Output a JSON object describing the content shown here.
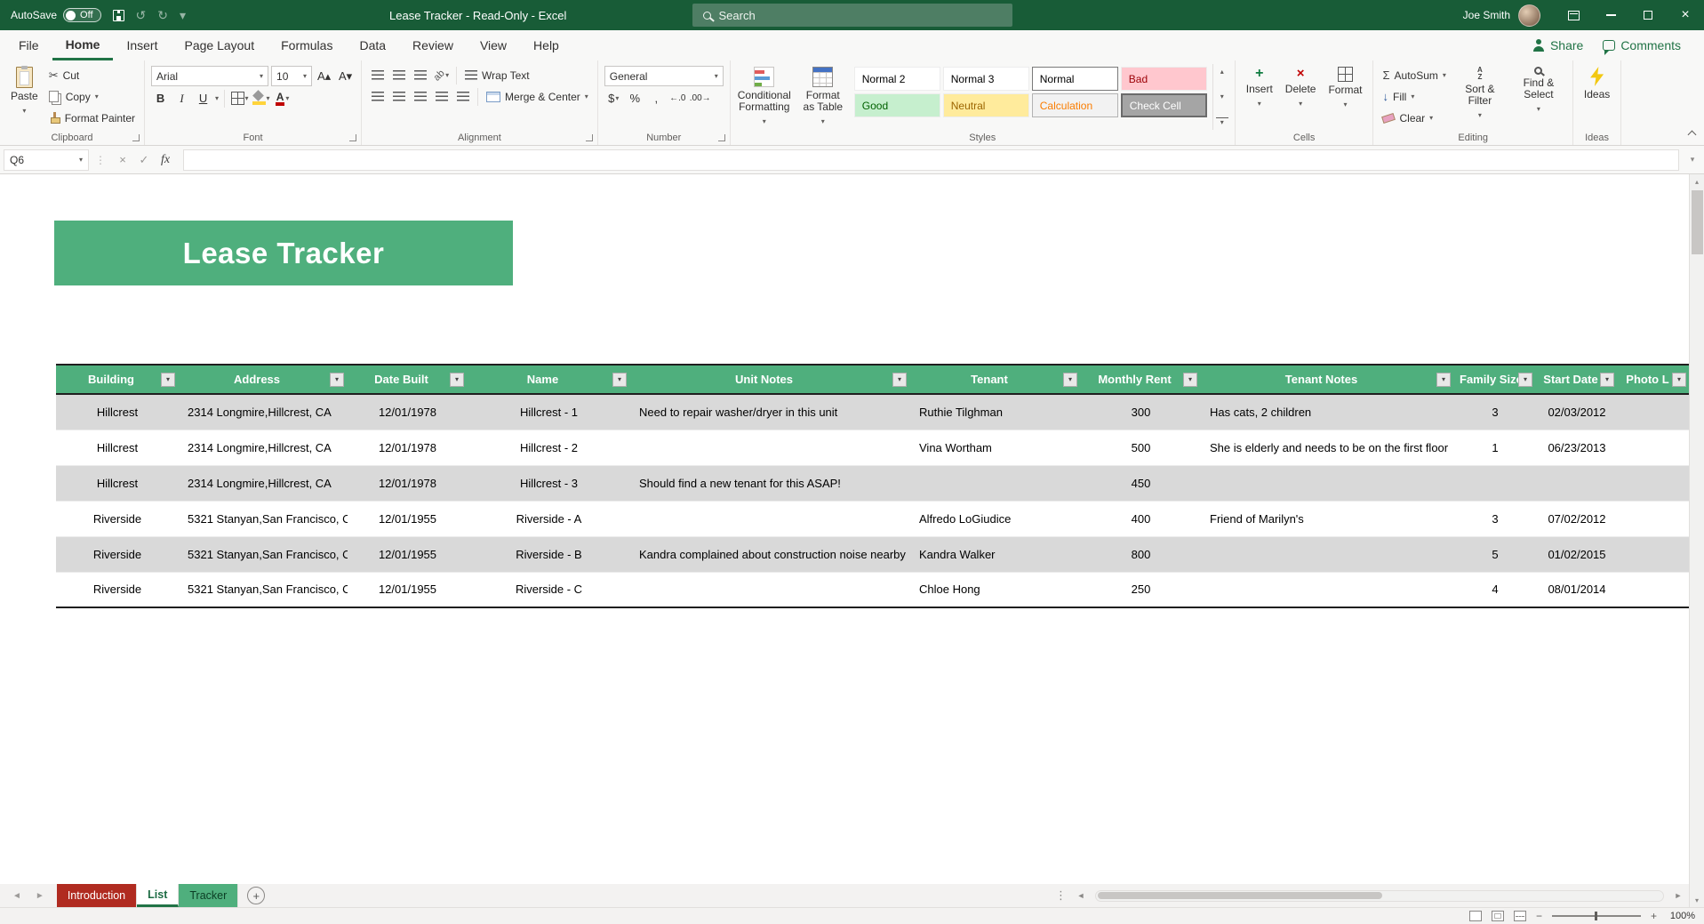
{
  "glyphs": {
    "dropdown": "▾",
    "scissors": "✂",
    "undo": "↺",
    "redo": "↻",
    "check": "✓",
    "cross": "×",
    "sigma": "Σ",
    "dollar": "$",
    "percent": "%",
    "comma": ",",
    "increase_decimal": "←.0",
    "decrease_decimal": ".00→",
    "font_grow": "A▴",
    "font_shrink": "A▾",
    "letter_a": "A",
    "letter_z": "Z",
    "ab": "ab",
    "fill_down": "↓",
    "plus": "+",
    "minus": "−",
    "nav_left": "◄",
    "nav_right": "►",
    "up_small": "▴",
    "down_small": "▾",
    "dots_v": "⋮"
  },
  "title_bar": {
    "autosave_label": "AutoSave",
    "autosave_state": "Off",
    "title": "Lease Tracker - Read-Only - Excel",
    "search_placeholder": "Search",
    "user_name": "Joe Smith"
  },
  "ribbon_tabs": {
    "items": [
      "File",
      "Home",
      "Insert",
      "Page Layout",
      "Formulas",
      "Data",
      "Review",
      "View",
      "Help"
    ],
    "active": "Home",
    "share_label": "Share",
    "comments_label": "Comments"
  },
  "ribbon": {
    "clipboard": {
      "group_label": "Clipboard",
      "paste_label": "Paste",
      "cut_label": "Cut",
      "copy_label": "Copy",
      "format_painter_label": "Format Painter"
    },
    "font": {
      "group_label": "Font",
      "font_name": "Arial",
      "font_size": "10",
      "bold_label": "B",
      "italic_label": "I",
      "underline_label": "U"
    },
    "alignment": {
      "group_label": "Alignment",
      "wrap_text_label": "Wrap Text",
      "merge_center_label": "Merge & Center"
    },
    "number": {
      "group_label": "Number",
      "format_value": "General"
    },
    "styles": {
      "group_label": "Styles",
      "conditional_formatting_label": "Conditional Formatting",
      "format_as_table_label": "Format as Table",
      "gallery": [
        {
          "label": "Normal 2",
          "kind": "plain"
        },
        {
          "label": "Normal 3",
          "kind": "plain"
        },
        {
          "label": "Normal",
          "kind": "selected"
        },
        {
          "label": "Bad",
          "kind": "bad"
        },
        {
          "label": "Good",
          "kind": "good"
        },
        {
          "label": "Neutral",
          "kind": "neutral"
        },
        {
          "label": "Calculation",
          "kind": "calculation"
        },
        {
          "label": "Check Cell",
          "kind": "checkcell"
        }
      ]
    },
    "cells": {
      "group_label": "Cells",
      "insert_label": "Insert",
      "delete_label": "Delete",
      "format_label": "Format"
    },
    "editing": {
      "group_label": "Editing",
      "autosum_label": "AutoSum",
      "fill_label": "Fill",
      "clear_label": "Clear",
      "sort_filter_label": "Sort & Filter",
      "find_select_label": "Find & Select"
    },
    "ideas": {
      "group_label": "Ideas",
      "button_label": "Ideas"
    }
  },
  "formula_bar": {
    "name_box_value": "Q6",
    "fx_label": "fx",
    "formula_value": ""
  },
  "sheet": {
    "banner_title": "Lease Tracker",
    "columns": [
      "Building",
      "Address",
      "Date Built",
      "Name",
      "Unit Notes",
      "Tenant",
      "Monthly Rent",
      "Tenant Notes",
      "Family Size",
      "Start Date",
      "Photo L"
    ],
    "rows": [
      [
        "Hillcrest",
        "2314 Longmire,Hillcrest, CA",
        "12/01/1978",
        "Hillcrest - 1",
        "Need to repair washer/dryer in this unit",
        "Ruthie Tilghman",
        "300",
        "Has cats, 2 children",
        "3",
        "02/03/2012"
      ],
      [
        "Hillcrest",
        "2314 Longmire,Hillcrest, CA",
        "12/01/1978",
        "Hillcrest - 2",
        "",
        "Vina Wortham",
        "500",
        "She is elderly and needs to be on the first floor",
        "1",
        "06/23/2013"
      ],
      [
        "Hillcrest",
        "2314 Longmire,Hillcrest, CA",
        "12/01/1978",
        "Hillcrest - 3",
        "Should find a new tenant for this ASAP!",
        "",
        "450",
        "",
        "",
        ""
      ],
      [
        "Riverside",
        "5321 Stanyan,San Francisco, C",
        "12/01/1955",
        "Riverside - A",
        "",
        "Alfredo LoGiudice",
        "400",
        "Friend of Marilyn's",
        "3",
        "07/02/2012"
      ],
      [
        "Riverside",
        "5321 Stanyan,San Francisco, C",
        "12/01/1955",
        "Riverside - B",
        "Kandra complained about construction noise nearby",
        "Kandra Walker",
        "800",
        "",
        "5",
        "01/02/2015"
      ],
      [
        "Riverside",
        "5321 Stanyan,San Francisco, C",
        "12/01/1955",
        "Riverside - C",
        "",
        "Chloe Hong",
        "250",
        "",
        "4",
        "08/01/2014"
      ]
    ]
  },
  "sheet_tabs": {
    "tabs": [
      {
        "label": "Introduction",
        "kind": "red"
      },
      {
        "label": "List",
        "kind": "active"
      },
      {
        "label": "Tracker",
        "kind": "green"
      }
    ],
    "add_label": "+"
  },
  "status_bar": {
    "zoom_level": "100%"
  },
  "colors": {
    "titlebar_green": "#185C37",
    "accent_green": "#217346",
    "banner_green": "#4FAF7D",
    "band_gray": "#D9D9D9",
    "tab_red": "#B02B20"
  }
}
